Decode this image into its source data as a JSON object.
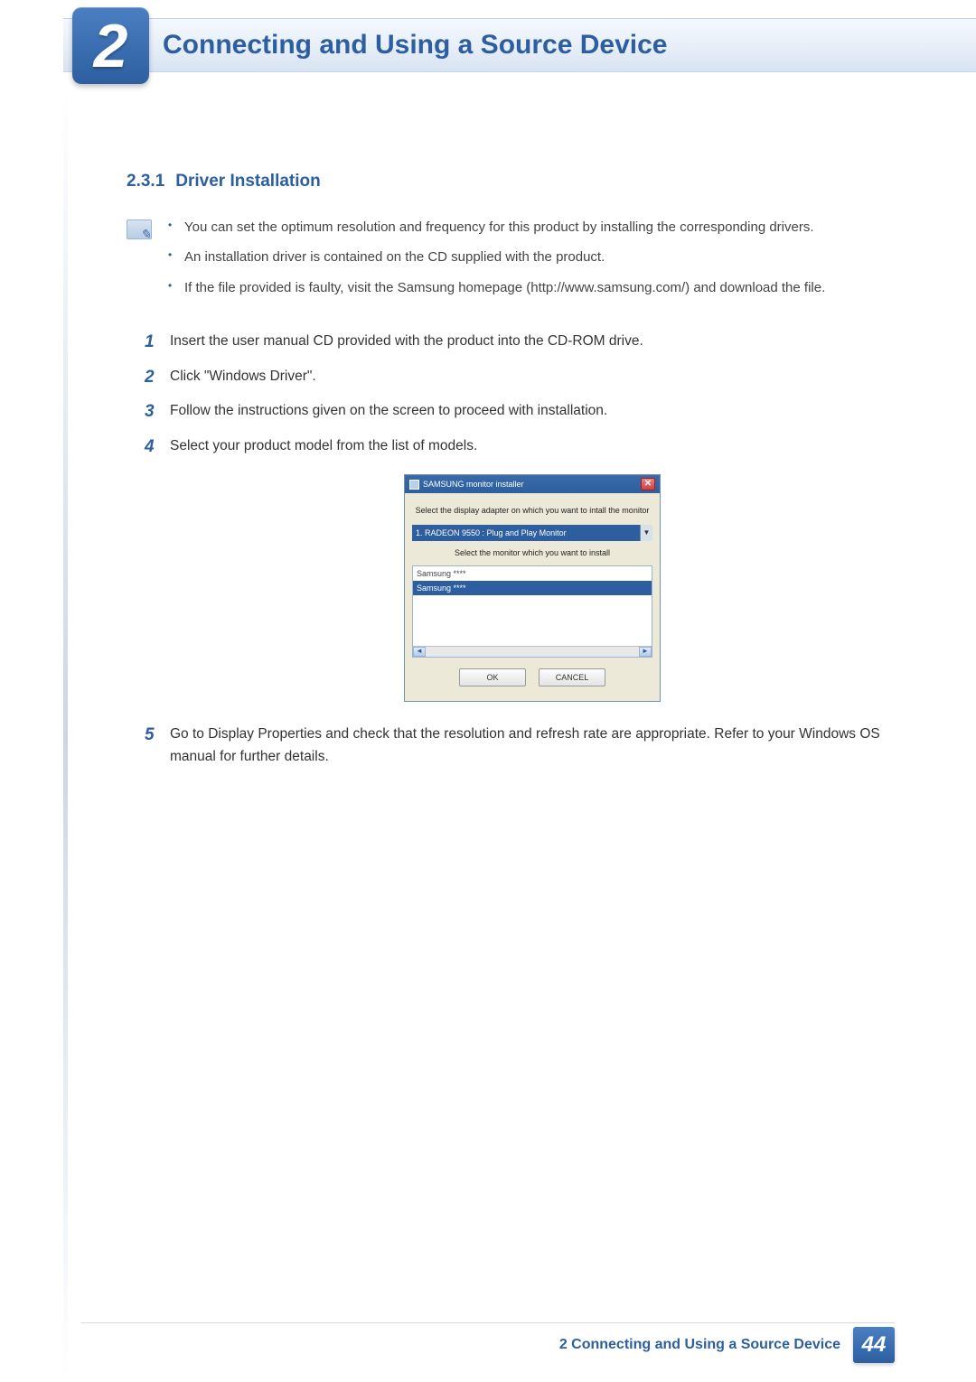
{
  "header": {
    "chapter_number": "2",
    "chapter_title": "Connecting and Using a Source Device"
  },
  "section": {
    "number": "2.3.1",
    "title": "Driver Installation"
  },
  "note_bullets": [
    "You can set the optimum resolution and frequency for this product by installing the corresponding drivers.",
    "An installation driver is contained on the CD supplied with the product.",
    "If the file provided is faulty, visit the Samsung homepage (http://www.samsung.com/) and download the file."
  ],
  "steps": [
    {
      "n": "1",
      "text": "Insert the user manual CD provided with the product into the CD-ROM drive."
    },
    {
      "n": "2",
      "text": "Click \"Windows Driver\"."
    },
    {
      "n": "3",
      "text": "Follow the instructions given on the screen to proceed with installation."
    },
    {
      "n": "4",
      "text": "Select your product model from the list of models."
    },
    {
      "n": "5",
      "text": "Go to Display Properties and check that the resolution and refresh rate are appropriate. Refer to your Windows OS manual for further details."
    }
  ],
  "dialog": {
    "title": "SAMSUNG monitor installer",
    "prompt_adapter": "Select the display adapter on which you want to intall the monitor",
    "adapter_selected": "1. RADEON 9550 : Plug and Play Monitor",
    "prompt_monitor": "Select the monitor which you want to install",
    "list_items": [
      "Samsung ****",
      "Samsung ****"
    ],
    "ok_label": "OK",
    "cancel_label": "CANCEL"
  },
  "footer": {
    "text": "2 Connecting and Using a Source Device",
    "page": "44"
  }
}
